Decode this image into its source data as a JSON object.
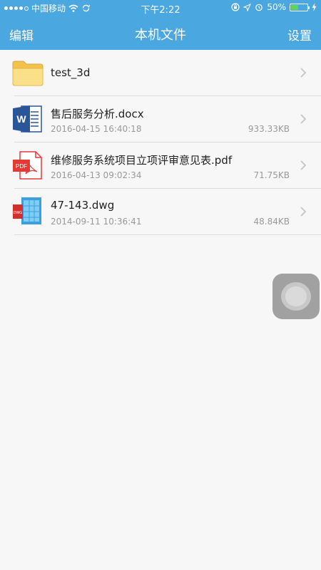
{
  "status_bar": {
    "carrier": "中国移动",
    "time": "下午2:22",
    "battery": "50%",
    "battery_level": 0.5
  },
  "nav": {
    "edit_label": "编辑",
    "title": "本机文件",
    "settings_label": "设置"
  },
  "files": [
    {
      "type": "folder",
      "name": "test_3d"
    },
    {
      "type": "docx",
      "name": "售后服务分析.docx",
      "date": "2016-04-15 16:40:18",
      "size": "933.33KB"
    },
    {
      "type": "pdf",
      "name": "维修服务系统项目立项评审意见表.pdf",
      "date": "2016-04-13 09:02:34",
      "size": "71.75KB"
    },
    {
      "type": "dwg",
      "name": "47-143.dwg",
      "date": "2014-09-11 10:36:41",
      "size": "48.84KB"
    }
  ],
  "colors": {
    "header": "#4aa7e0",
    "background": "#f7f7f7",
    "word_blue": "#2a5699",
    "pdf_red": "#e53935"
  },
  "icons": [
    "folder-icon",
    "word-doc-icon",
    "pdf-icon",
    "dwg-icon",
    "chevron-right-icon",
    "assistive-touch-icon"
  ]
}
